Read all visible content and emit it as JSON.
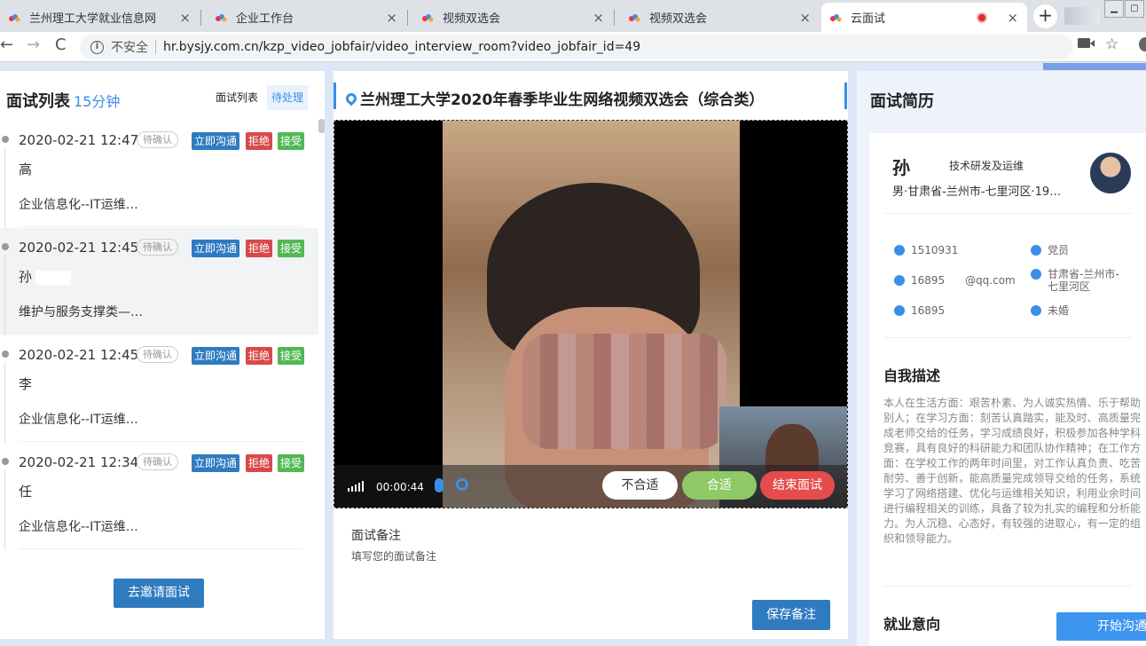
{
  "browser": {
    "tabs": [
      {
        "title": "兰州理工大学就业信息网",
        "close": "×"
      },
      {
        "title": "企业工作台",
        "close": "×"
      },
      {
        "title": "视频双选会",
        "close": "×"
      },
      {
        "title": "视频双选会",
        "close": "×"
      },
      {
        "title": "云面试",
        "close": "×",
        "active": true
      }
    ],
    "new_tab": "+",
    "back": "←",
    "forward": "→",
    "reload": "C",
    "info": "i",
    "insecure_label": "不安全",
    "url": "hr.bysjy.com.cn/kzp_video_jobfair/video_interview_room?video_jobfair_id=49",
    "star": "☆"
  },
  "left": {
    "title": "面试列表",
    "subtitle": "15分钟",
    "tab_list": "面试列表",
    "tab_pending": "待处理",
    "items": [
      {
        "time": "2020-02-21 12:47",
        "status": "待确认",
        "chat": "立即沟通",
        "reject": "拒绝",
        "accept": "接受",
        "name": "高",
        "job": "企业信息化--IT运维…"
      },
      {
        "time": "2020-02-21 12:45",
        "status": "待确认",
        "chat": "立即沟通",
        "reject": "拒绝",
        "accept": "接受",
        "name": "孙",
        "job": "维护与服务支撑类—…"
      },
      {
        "time": "2020-02-21 12:45",
        "status": "待确认",
        "chat": "立即沟通",
        "reject": "拒绝",
        "accept": "接受",
        "name": "李",
        "job": "企业信息化--IT运维…"
      },
      {
        "time": "2020-02-21 12:34",
        "status": "待确认",
        "chat": "立即沟通",
        "reject": "拒绝",
        "accept": "接受",
        "name": "任",
        "job": "企业信息化--IT运维…"
      }
    ],
    "invite_button": "去邀请面试"
  },
  "middle": {
    "title": "兰州理工大学2020年春季毕业生网络视频双选会（综合类）",
    "timer": "00:00:44",
    "btn_unfit": "不合适",
    "btn_fit": "合适",
    "btn_end": "结束面试",
    "notes_label": "面试备注",
    "notes_placeholder": "填写您的面试备注",
    "save_button": "保存备注"
  },
  "right": {
    "title": "面试简历",
    "name": "孙",
    "role": "技术研发及运维",
    "basic": "男·甘肃省-兰州市-七里河区·19…",
    "facts": {
      "phone": "1510931",
      "party": "党员",
      "email": "16895      @qq.com",
      "location": "甘肃省-兰州市-七里河区",
      "wechat": "16895",
      "marital": "未婚"
    },
    "self_desc_title": "自我描述",
    "self_desc": "本人在生活方面：艰苦朴素、为人诚实热情、乐于帮助别人；在学习方面：刻苦认真踏实，能及时、高质量完成老师交给的任务，学习成绩良好，积极参加各种学科竞赛，具有良好的科研能力和团队协作精神；在工作方面：在学校工作的两年时间里，对工作认真负责、吃苦耐劳、善于创新，能高质量完成领导交给的任务，系统学习了网络搭建、优化与运维相关知识，利用业余时间进行编程相关的训练，具备了较为扎实的编程和分析能力。为人沉稳、心态好，有较强的进取心，有一定的组织和领导能力。",
    "job_intent_title": "就业意向",
    "start_button": "开始沟通"
  },
  "colors": {
    "primary": "#2f7bc0",
    "accent": "#3a8ee6",
    "reject": "#d84a4a",
    "accept": "#52b854",
    "end": "#e64c4c",
    "fit": "#8fc966"
  }
}
